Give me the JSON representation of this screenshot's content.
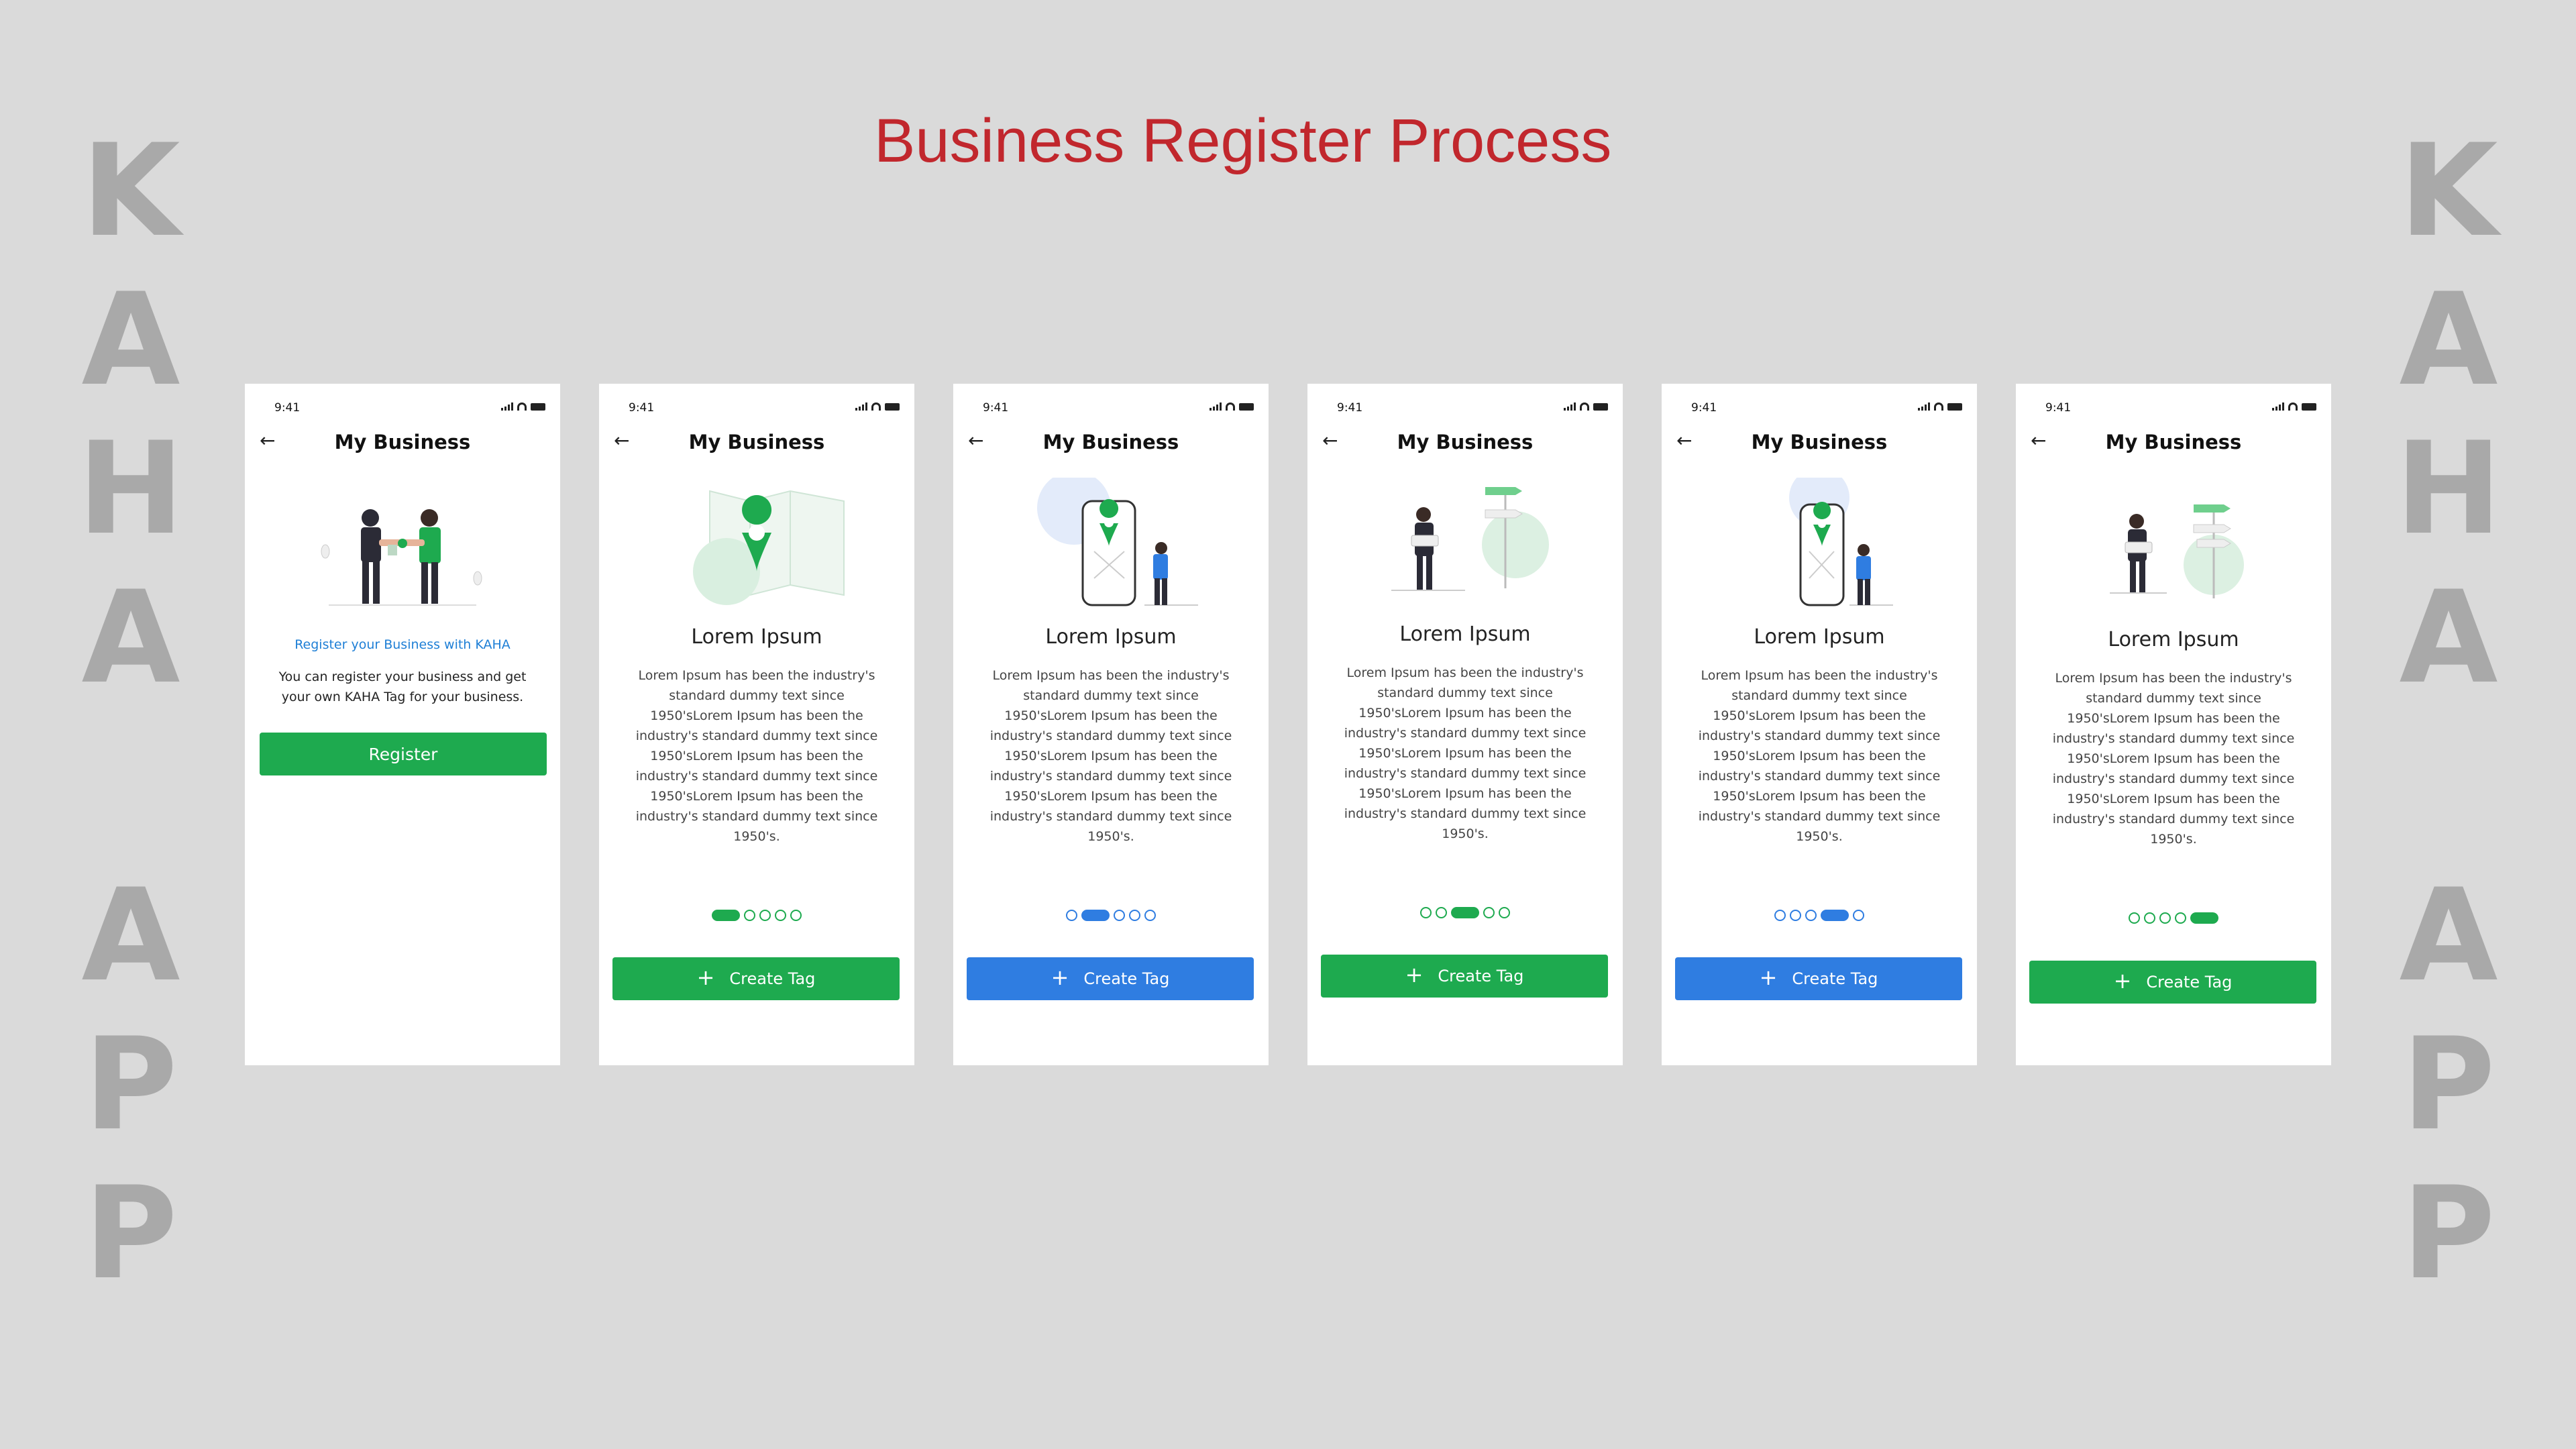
{
  "page": {
    "title": "Business Register Process",
    "side_letters_top": [
      "K",
      "A",
      "H",
      "A"
    ],
    "side_letters_bottom": [
      "A",
      "P",
      "P"
    ],
    "accent_title_color": "#c1272d",
    "green": "#1eaa4f",
    "blue": "#2f7de1"
  },
  "phones": [
    {
      "time": "9:41",
      "nav_title": "My Business",
      "illustration": "handshake-illustration",
      "link_text": "Register your Business with KAHA",
      "description": "You can register your business and get your own KAHA Tag for your business.",
      "button_label": "Register"
    },
    {
      "time": "9:41",
      "nav_title": "My Business",
      "illustration": "map-pin-illustration",
      "heading": "Lorem Ipsum",
      "body": "Lorem Ipsum has been the industry's standard dummy text since 1950'sLorem Ipsum has been the industry's standard dummy text since 1950'sLorem Ipsum has been the industry's standard dummy text since 1950'sLorem Ipsum has been the industry's standard dummy text since 1950's.",
      "active_dot": 0,
      "theme": "green",
      "button_label": "Create Tag"
    },
    {
      "time": "9:41",
      "nav_title": "My Business",
      "illustration": "phone-person-illustration",
      "heading": "Lorem Ipsum",
      "body": "Lorem Ipsum has been the industry's standard dummy text since 1950'sLorem Ipsum has been the industry's standard dummy text since 1950'sLorem Ipsum has been the industry's standard dummy text since 1950'sLorem Ipsum has been the industry's standard dummy text since 1950's.",
      "active_dot": 1,
      "theme": "blue",
      "button_label": "Create Tag"
    },
    {
      "time": "9:41",
      "nav_title": "My Business",
      "illustration": "signpost-person-illustration",
      "heading": "Lorem Ipsum",
      "body": "Lorem Ipsum has been the industry's standard dummy text since 1950'sLorem Ipsum has been the industry's standard dummy text since 1950'sLorem Ipsum has been the industry's standard dummy text since 1950'sLorem Ipsum has been the industry's standard dummy text since 1950's.",
      "active_dot": 2,
      "theme": "green",
      "button_label": "Create Tag"
    },
    {
      "time": "9:41",
      "nav_title": "My Business",
      "illustration": "phone-person-illustration",
      "heading": "Lorem Ipsum",
      "body": "Lorem Ipsum has been the industry's standard dummy text since 1950'sLorem Ipsum has been the industry's standard dummy text since 1950'sLorem Ipsum has been the industry's standard dummy text since 1950'sLorem Ipsum has been the industry's standard dummy text since 1950's.",
      "active_dot": 3,
      "theme": "blue",
      "button_label": "Create Tag"
    },
    {
      "time": "9:41",
      "nav_title": "My Business",
      "illustration": "signpost-person-illustration",
      "heading": "Lorem Ipsum",
      "body": "Lorem Ipsum has been the industry's standard dummy text since 1950'sLorem Ipsum has been the industry's standard dummy text since 1950'sLorem Ipsum has been the industry's standard dummy text since 1950'sLorem Ipsum has been the industry's standard dummy text since 1950's.",
      "active_dot": 4,
      "theme": "green",
      "button_label": "Create Tag"
    }
  ]
}
